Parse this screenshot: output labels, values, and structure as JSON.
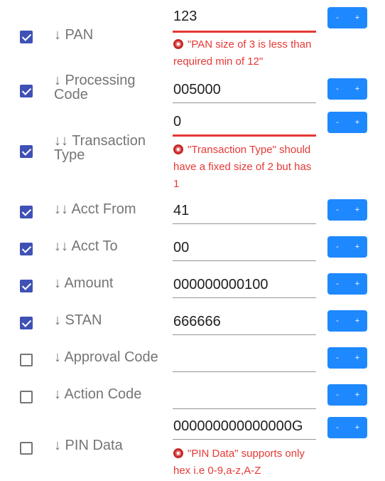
{
  "fields": [
    {
      "label": "↓ PAN",
      "value": "123",
      "checked": true,
      "error": "\"PAN size of 3 is less than required min of 12\""
    },
    {
      "label": "↓ Processing Code",
      "value": "005000",
      "checked": true,
      "error": ""
    },
    {
      "label": "↓↓ Transaction Type",
      "value": "0",
      "checked": true,
      "error": "\"Transaction Type\" should have a fixed size of 2 but has 1"
    },
    {
      "label": "↓↓ Acct From",
      "value": "41",
      "checked": true,
      "error": ""
    },
    {
      "label": "↓↓ Acct To",
      "value": "00",
      "checked": true,
      "error": ""
    },
    {
      "label": "↓ Amount",
      "value": "000000000100",
      "checked": true,
      "error": ""
    },
    {
      "label": "↓ STAN",
      "value": "666666",
      "checked": true,
      "error": ""
    },
    {
      "label": "↓ Approval Code",
      "value": "",
      "checked": false,
      "error": ""
    },
    {
      "label": "↓ Action Code",
      "value": "",
      "checked": false,
      "error": ""
    },
    {
      "label": "↓ PIN Data",
      "value": "000000000000000G",
      "checked": false,
      "error": "\"PIN Data\" supports only hex i.e 0-9,a-z,A-Z"
    }
  ],
  "buttons": {
    "minus": "-",
    "plus": "+"
  },
  "colors": {
    "checkbox": "#3f51b5",
    "button": "#1e88ff",
    "error": "#e53935"
  }
}
